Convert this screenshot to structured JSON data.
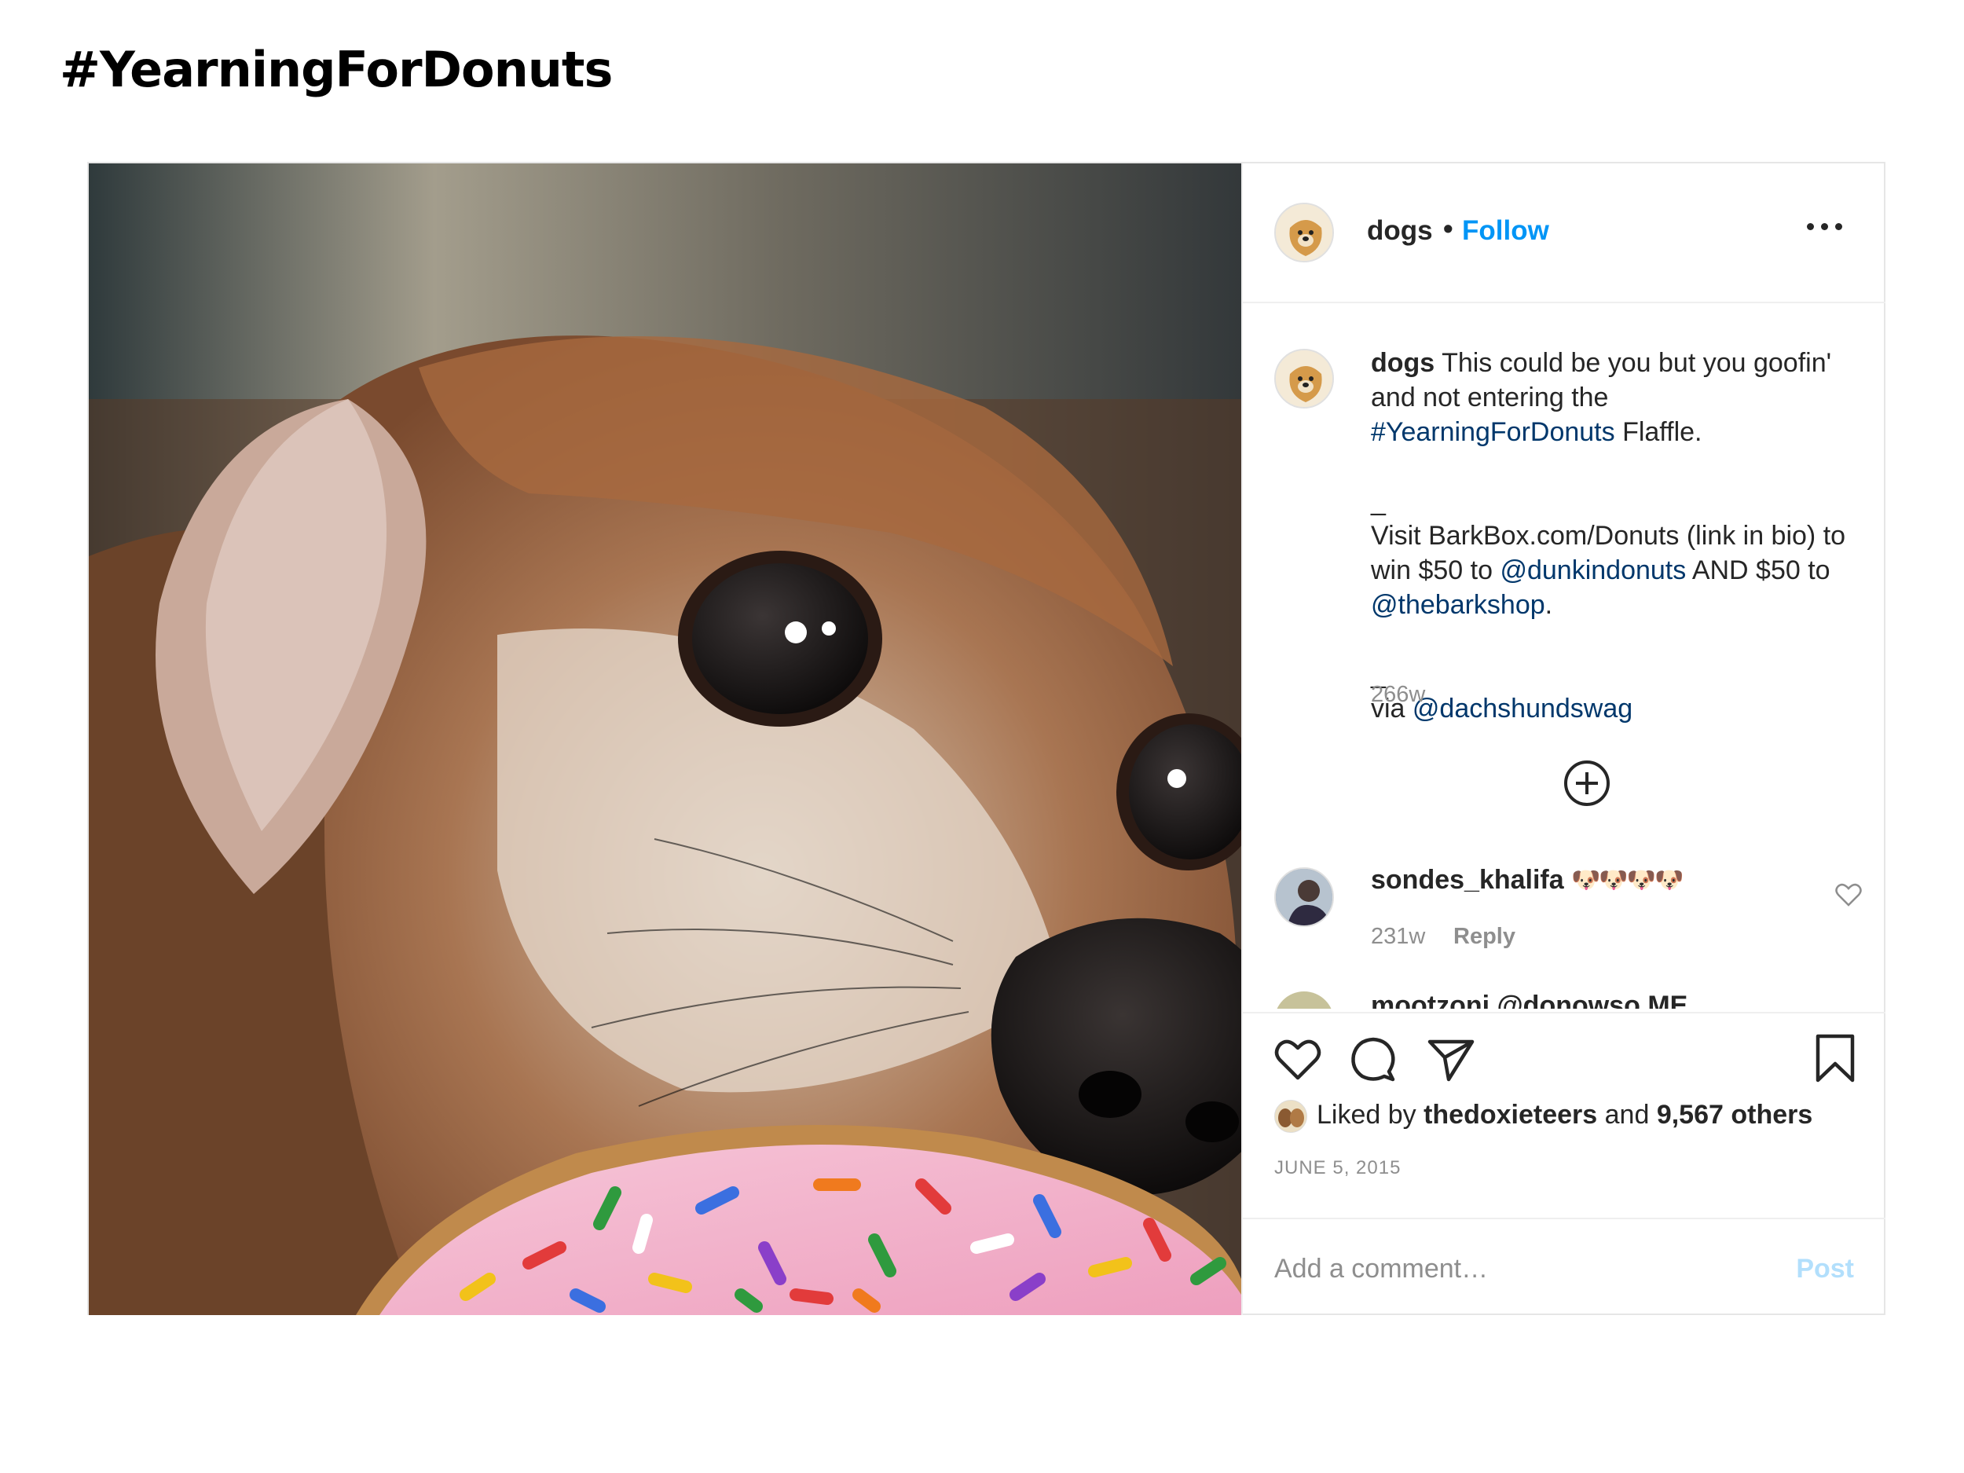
{
  "page": {
    "heading": "#YearningForDonuts"
  },
  "post": {
    "photo": {
      "alt": "dog-with-sprinkle-donut-photo"
    },
    "header": {
      "username": "dogs",
      "separator": "•",
      "follow_label": "Follow",
      "more_icon": "more-horizontal-icon"
    },
    "caption": {
      "username": "dogs",
      "line1_text": "This could be you but you goofin' and not entering the",
      "hashtag": "#YearningForDonuts",
      "line1_end": "Flaffle.",
      "separator1": "_",
      "line2_text": "Visit BarkBox.com/Donuts (link in bio) to win $50 to",
      "mention1": "@dunkindonuts",
      "line2_mid": "AND $50 to",
      "mention2": "@thebarkshop",
      "line2_end": ".",
      "separator2": "_",
      "line3_text": "via",
      "mention3": "@dachshundswag",
      "age": "266w"
    },
    "load_more_icon": "plus-circle-icon",
    "comments": [
      {
        "username": "sondes_khalifa",
        "text": "🐶🐶🐶🐶",
        "age": "231w",
        "reply_label": "Reply",
        "like_icon": "heart-outline-icon"
      }
    ],
    "cut_comment_text": "mootzoni @donowso ME",
    "actions": {
      "like_icon": "heart-outline-icon",
      "comment_icon": "comment-bubble-icon",
      "share_icon": "paper-plane-icon",
      "save_icon": "bookmark-icon"
    },
    "likes": {
      "prefix": "Liked by",
      "user": "thedoxieteers",
      "joiner": "and",
      "others": "9,567 others"
    },
    "date": "JUNE 5, 2015",
    "add_comment": {
      "placeholder": "Add a comment…",
      "post_label": "Post"
    }
  },
  "colors": {
    "link_blue": "#0095f6",
    "mention_navy": "#00376b",
    "muted": "#8e8e8e",
    "post_disabled": "#b2dffc"
  }
}
